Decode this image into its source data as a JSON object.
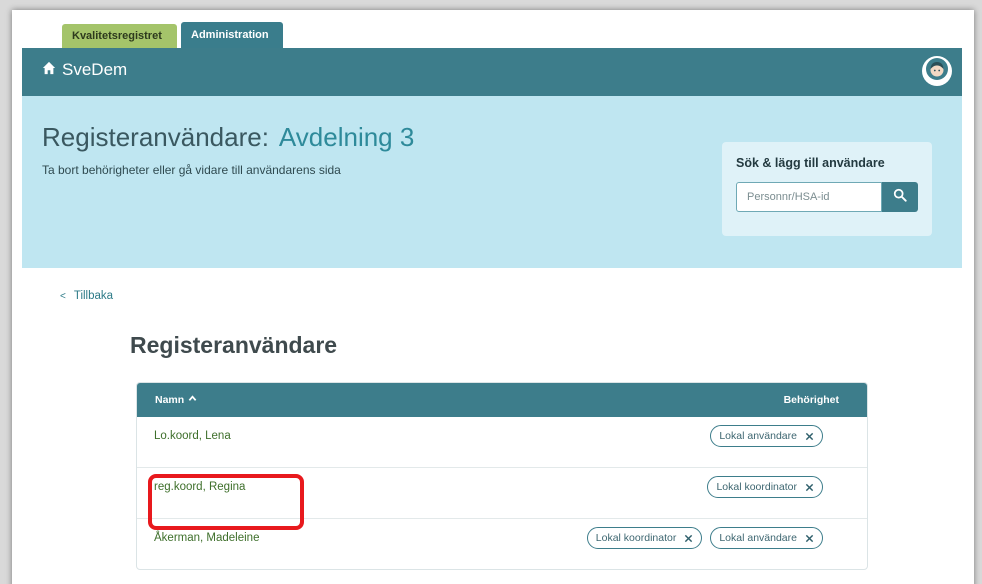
{
  "tabs": [
    {
      "label": "Kvalitetsregistret"
    },
    {
      "label": "Administration"
    }
  ],
  "topbar": {
    "brand": "SveDem"
  },
  "hero": {
    "title": "Registeranvändare:",
    "department": "Avdelning 3",
    "subtitle": "Ta bort behörigheter eller gå vidare till användarens sida"
  },
  "search": {
    "title": "Sök & lägg till användare",
    "placeholder": "Personnr/HSA-id"
  },
  "back": {
    "label": "Tillbaka"
  },
  "section": {
    "title": "Registeranvändare"
  },
  "table": {
    "columns": {
      "name": "Namn",
      "permission": "Behörighet"
    },
    "rows": [
      {
        "name": "Lo.koord, Lena",
        "chips": [
          "Lokal användare"
        ]
      },
      {
        "name": "reg.koord, Regina",
        "chips": [
          "Lokal koordinator"
        ]
      },
      {
        "name": "Åkerman, Madeleine",
        "chips": [
          "Lokal koordinator",
          "Lokal användare"
        ]
      }
    ]
  },
  "colors": {
    "brand": "#3d7d8b",
    "hero": "#bfe6f1",
    "tab_green": "#a4c46a",
    "highlight": "#e8191d"
  }
}
